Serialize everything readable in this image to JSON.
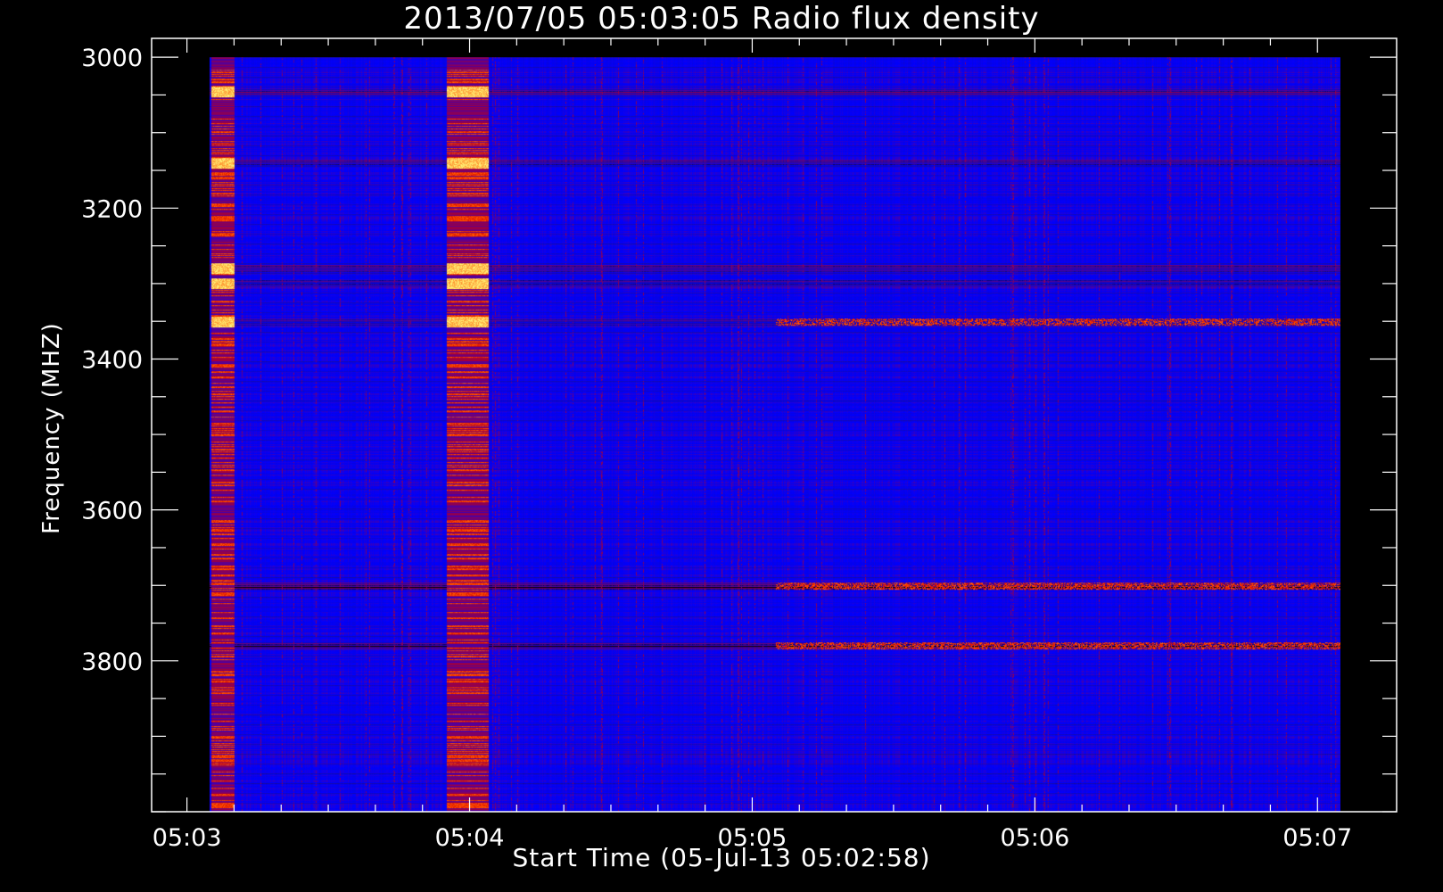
{
  "chart_data": {
    "type": "heatmap",
    "title": "2013/07/05 05:03:05 Radio flux density",
    "xlabel": "Start Time (05-Jul-13 05:02:58)",
    "ylabel": "Frequency (MHZ)",
    "x_ticks": [
      "05:03",
      "05:04",
      "05:05",
      "05:06",
      "05:07"
    ],
    "x_tick_minutes": [
      0,
      1,
      2,
      3,
      4
    ],
    "x_range_minutes": [
      -0.125,
      4.28
    ],
    "data_x_range_minutes": [
      0.08,
      4.08
    ],
    "y_ticks": [
      3000,
      3200,
      3400,
      3600,
      3800
    ],
    "y_minor_step": 50,
    "y_range": [
      2975,
      4000
    ],
    "data_y_range": [
      3000,
      4000
    ],
    "y_reversed": true,
    "colormap": [
      "#000000",
      "#1a0a9f",
      "#0000ff",
      "#d40000",
      "#ff5500",
      "#ffff80"
    ],
    "background_level": "blue",
    "bright_bursts": [
      {
        "start": "05:03:05",
        "end": "05:03:10",
        "level": "high"
      },
      {
        "start": "05:03:55",
        "end": "05:04:04",
        "level": "high"
      }
    ],
    "persistent_bands_mhz": [
      3045,
      3140,
      3280,
      3300,
      3350,
      3700,
      3780
    ]
  }
}
